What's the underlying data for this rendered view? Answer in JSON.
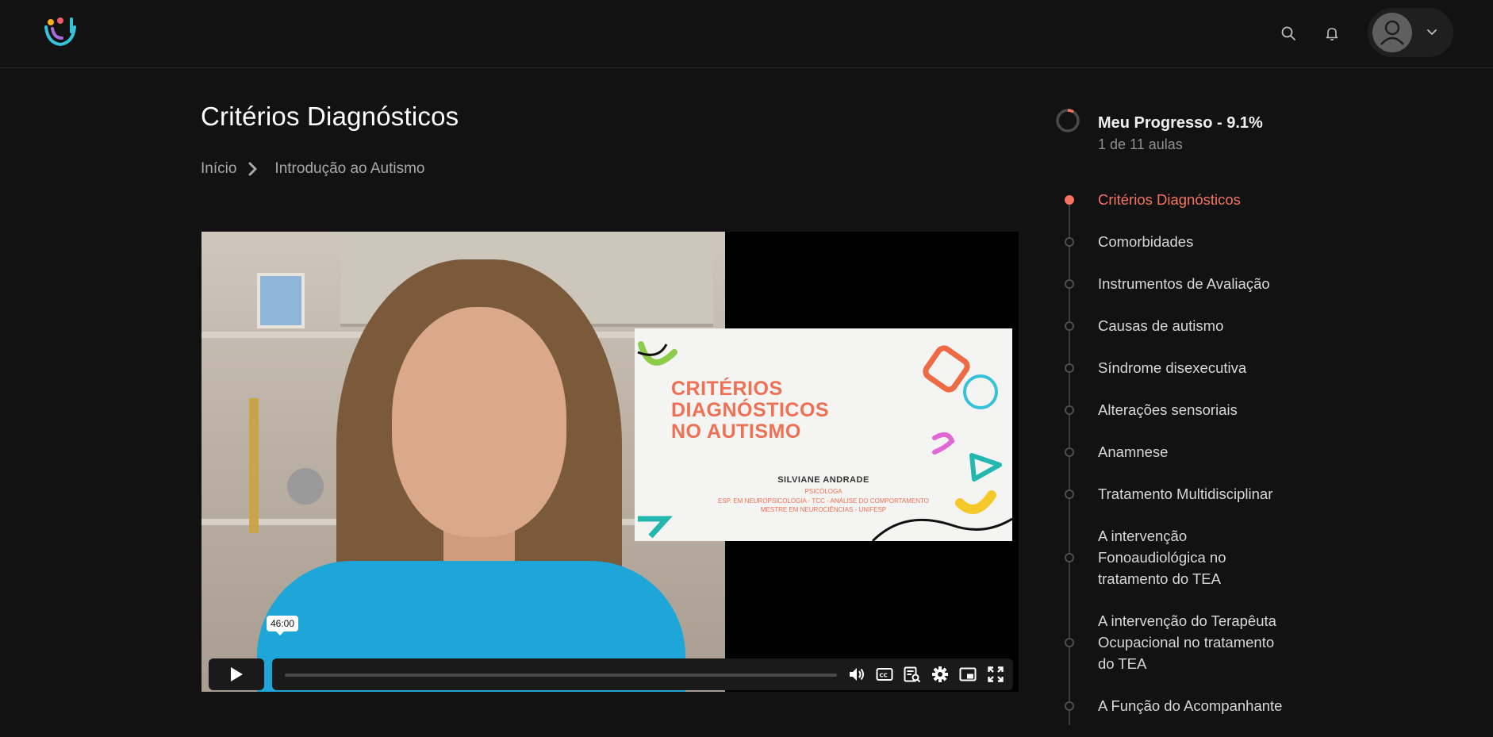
{
  "header": {
    "logo_name": "brand-logo",
    "icons": [
      "search-icon",
      "bell-icon",
      "user-avatar-icon",
      "chevron-down-icon"
    ]
  },
  "page": {
    "title": "Critérios Diagnósticos",
    "breadcrumb": {
      "home": "Início",
      "current": "Introdução ao Autismo"
    }
  },
  "video": {
    "slide": {
      "title_lines": [
        "CRITÉRIOS",
        "DIAGNÓSTICOS",
        "NO AUTISMO"
      ],
      "presenter": "SILVIANE ANDRADE",
      "role": "PSICÓLOGA",
      "line1": "ESP. EM NEUROPSICOLOGIA - TCC - ANÁLISE DO COMPORTAMENTO",
      "line2": "MESTRE EM NEUROCIÊNCIAS - UNIFESP"
    },
    "hover_time": "46:00",
    "progress_fraction": 0,
    "controls": [
      "play-icon",
      "volume-icon",
      "captions-icon",
      "transcript-icon",
      "settings-icon",
      "pip-icon",
      "fullscreen-icon"
    ]
  },
  "progress": {
    "title": "Meu Progresso - 9.1%",
    "subtitle": "1 de 11 aulas",
    "percent": 9.1,
    "accent_color": "#f37361"
  },
  "lessons": [
    {
      "label": "Critérios Diagnósticos",
      "active": true
    },
    {
      "label": "Comorbidades",
      "active": false
    },
    {
      "label": "Instrumentos de Avaliação",
      "active": false
    },
    {
      "label": "Causas de autismo",
      "active": false
    },
    {
      "label": "Síndrome disexecutiva",
      "active": false
    },
    {
      "label": "Alterações sensoriais",
      "active": false
    },
    {
      "label": "Anamnese",
      "active": false
    },
    {
      "label": "Tratamento Multidisciplinar",
      "active": false
    },
    {
      "label": "A intervenção Fonoaudiológica no tratamento do TEA",
      "active": false
    },
    {
      "label": "A intervenção do Terapêuta Ocupacional no tratamento do TEA",
      "active": false
    },
    {
      "label": "A Função do Acompanhante",
      "active": false
    }
  ]
}
